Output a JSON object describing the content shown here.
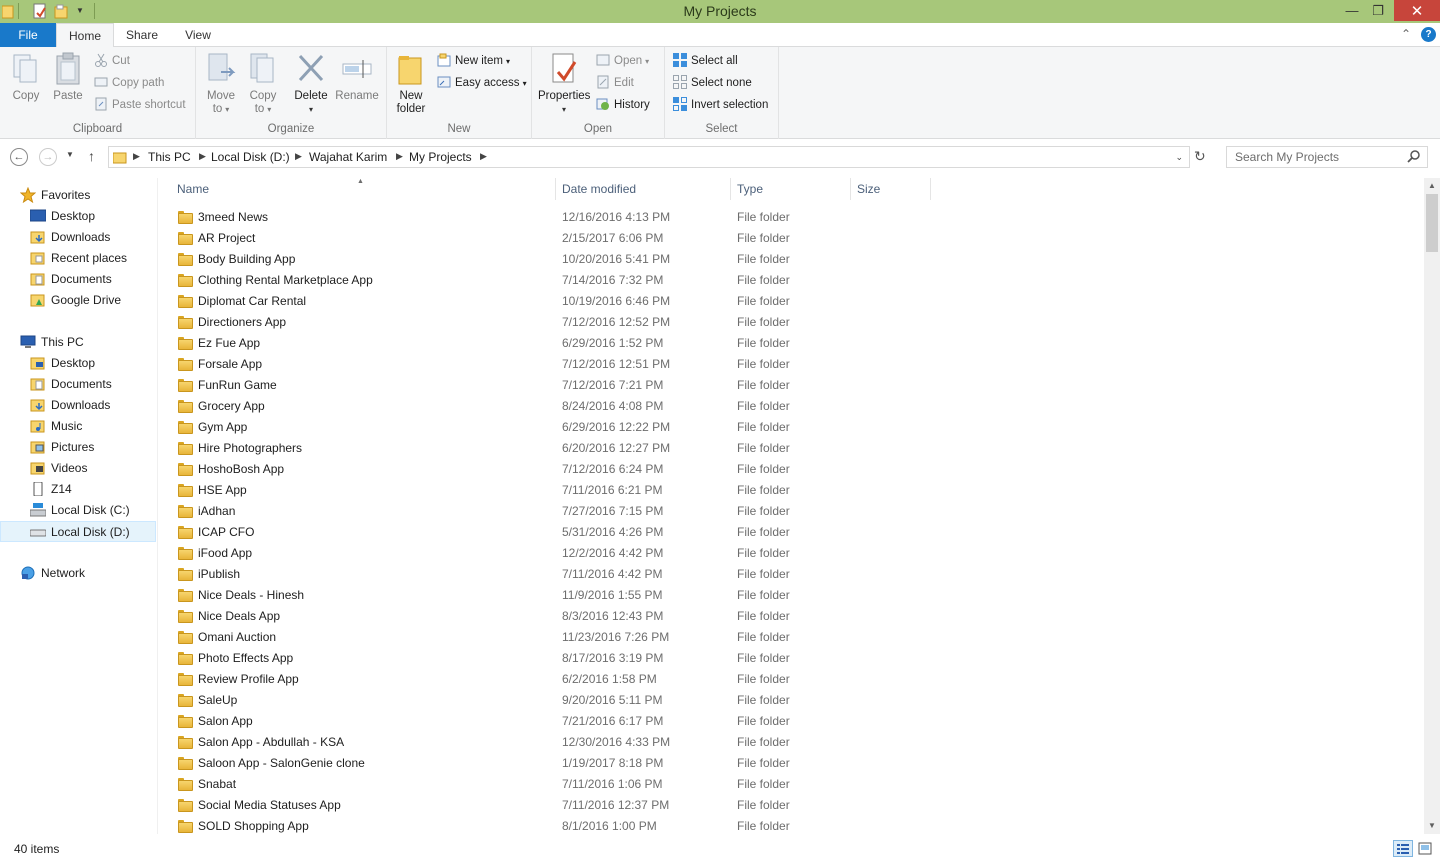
{
  "window": {
    "title": "My Projects",
    "minimize": "—",
    "restore": "❐",
    "close": "✕"
  },
  "ribbon": {
    "tabs": {
      "file": "File",
      "home": "Home",
      "share": "Share",
      "view": "View"
    },
    "help": "?",
    "collapse": "⌃",
    "clipboard": {
      "label": "Clipboard",
      "copy": "Copy",
      "paste": "Paste",
      "cut": "Cut",
      "copy_path": "Copy path",
      "paste_shortcut": "Paste shortcut"
    },
    "organize": {
      "label": "Organize",
      "move_to_1": "Move",
      "move_to_2": "to",
      "copy_to_1": "Copy",
      "copy_to_2": "to",
      "delete": "Delete",
      "rename": "Rename"
    },
    "new": {
      "label": "New",
      "new_folder_1": "New",
      "new_folder_2": "folder",
      "new_item": "New item",
      "easy_access": "Easy access"
    },
    "open": {
      "label": "Open",
      "properties": "Properties",
      "open": "Open",
      "edit": "Edit",
      "history": "History"
    },
    "select": {
      "label": "Select",
      "select_all": "Select all",
      "select_none": "Select none",
      "invert_selection": "Invert selection"
    }
  },
  "address": {
    "crumbs": [
      "This PC",
      "Local Disk (D:)",
      "Wajahat Karim",
      "My Projects"
    ],
    "search_placeholder": "Search My Projects"
  },
  "nav": {
    "favorites": "Favorites",
    "favorites_items": [
      "Desktop",
      "Downloads",
      "Recent places",
      "Documents",
      "Google Drive"
    ],
    "this_pc": "This PC",
    "this_pc_items": [
      "Desktop",
      "Documents",
      "Downloads",
      "Music",
      "Pictures",
      "Videos",
      "Z14",
      "Local Disk (C:)",
      "Local Disk (D:)"
    ],
    "network": "Network"
  },
  "columns": {
    "name": "Name",
    "date": "Date modified",
    "type": "Type",
    "size": "Size"
  },
  "files": [
    {
      "name": "3meed News",
      "date": "12/16/2016 4:13 PM",
      "type": "File folder"
    },
    {
      "name": "AR Project",
      "date": "2/15/2017 6:06 PM",
      "type": "File folder"
    },
    {
      "name": "Body Building App",
      "date": "10/20/2016 5:41 PM",
      "type": "File folder"
    },
    {
      "name": "Clothing Rental Marketplace App",
      "date": "7/14/2016 7:32 PM",
      "type": "File folder"
    },
    {
      "name": "Diplomat Car Rental",
      "date": "10/19/2016 6:46 PM",
      "type": "File folder"
    },
    {
      "name": "Directioners App",
      "date": "7/12/2016 12:52 PM",
      "type": "File folder"
    },
    {
      "name": "Ez Fue App",
      "date": "6/29/2016 1:52 PM",
      "type": "File folder"
    },
    {
      "name": "Forsale App",
      "date": "7/12/2016 12:51 PM",
      "type": "File folder"
    },
    {
      "name": "FunRun Game",
      "date": "7/12/2016 7:21 PM",
      "type": "File folder"
    },
    {
      "name": "Grocery App",
      "date": "8/24/2016 4:08 PM",
      "type": "File folder"
    },
    {
      "name": "Gym App",
      "date": "6/29/2016 12:22 PM",
      "type": "File folder"
    },
    {
      "name": "Hire Photographers",
      "date": "6/20/2016 12:27 PM",
      "type": "File folder"
    },
    {
      "name": "HoshoBosh App",
      "date": "7/12/2016 6:24 PM",
      "type": "File folder"
    },
    {
      "name": "HSE App",
      "date": "7/11/2016 6:21 PM",
      "type": "File folder"
    },
    {
      "name": "iAdhan",
      "date": "7/27/2016 7:15 PM",
      "type": "File folder"
    },
    {
      "name": "ICAP CFO",
      "date": "5/31/2016 4:26 PM",
      "type": "File folder"
    },
    {
      "name": "iFood App",
      "date": "12/2/2016 4:42 PM",
      "type": "File folder"
    },
    {
      "name": "iPublish",
      "date": "7/11/2016 4:42 PM",
      "type": "File folder"
    },
    {
      "name": "Nice Deals - Hinesh",
      "date": "11/9/2016 1:55 PM",
      "type": "File folder"
    },
    {
      "name": "Nice Deals App",
      "date": "8/3/2016 12:43 PM",
      "type": "File folder"
    },
    {
      "name": "Omani Auction",
      "date": "11/23/2016 7:26 PM",
      "type": "File folder"
    },
    {
      "name": "Photo Effects App",
      "date": "8/17/2016 3:19 PM",
      "type": "File folder"
    },
    {
      "name": "Review Profile App",
      "date": "6/2/2016 1:58 PM",
      "type": "File folder"
    },
    {
      "name": "SaleUp",
      "date": "9/20/2016 5:11 PM",
      "type": "File folder"
    },
    {
      "name": "Salon App",
      "date": "7/21/2016 6:17 PM",
      "type": "File folder"
    },
    {
      "name": "Salon App - Abdullah - KSA",
      "date": "12/30/2016 4:33 PM",
      "type": "File folder"
    },
    {
      "name": "Saloon App - SalonGenie clone",
      "date": "1/19/2017 8:18 PM",
      "type": "File folder"
    },
    {
      "name": "Snabat",
      "date": "7/11/2016 1:06 PM",
      "type": "File folder"
    },
    {
      "name": "Social Media Statuses App",
      "date": "7/11/2016 12:37 PM",
      "type": "File folder"
    },
    {
      "name": "SOLD Shopping App",
      "date": "8/1/2016 1:00 PM",
      "type": "File folder"
    }
  ],
  "status": {
    "count": "40 items"
  },
  "colors": {
    "titlebar": "#a7c77a",
    "file_tab": "#1979ca",
    "close_button": "#c7453b",
    "folder": "#f7d56e",
    "selection": "#e5f3fb"
  }
}
